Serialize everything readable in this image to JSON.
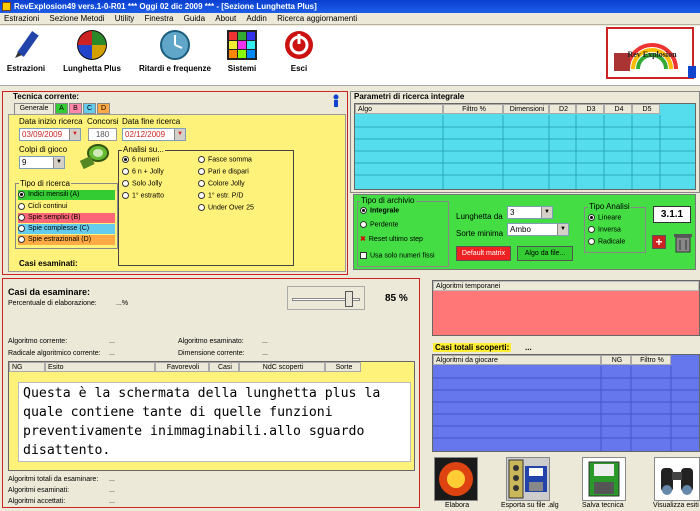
{
  "window": {
    "title": "RevExplosion49 vers.1-0-R01  ***  Oggi 02 dic 2009  ***  - [Sezione Lunghetta Plus]"
  },
  "menu": [
    "Estrazioni",
    "Sezione Metodi",
    "Utility",
    "Finestra",
    "Guida",
    "About",
    "Addin",
    "Ricerca aggiornamenti"
  ],
  "toolbar": {
    "estrazioni": "Estrazioni",
    "lunghetta": "Lunghetta Plus",
    "ritardi": "Ritardi e frequenze",
    "sistemi": "Sistemi",
    "esci": "Esci"
  },
  "logo": {
    "text": "Rev Explosion"
  },
  "tecnica": {
    "title": "Tecnica corrente:",
    "tabs": [
      "Generale",
      "A",
      "B",
      "C",
      "D"
    ],
    "data_inizio_label": "Data inizio ricerca",
    "data_inizio": "03/09/2009",
    "concorsi_label": "Concorsi",
    "concorsi": "180",
    "data_fine_label": "Data fine ricerca",
    "data_fine": "02/12/2009",
    "colpi_label": "Colpi di gioco",
    "colpi": "9",
    "tipo_label": "Tipo di ricerca",
    "tipi": [
      "Indici mensili (A)",
      "Cicli continui",
      "Spie semplici (B)",
      "Spie complesse (C)",
      "Spie estrazionali (D)"
    ],
    "analisi_label": "Analisi su...",
    "analisi_left": [
      "6 numeri",
      "6 n + Jolly",
      "Solo Jolly",
      "1° estratto"
    ],
    "analisi_right": [
      "Fasce somma",
      "Pari e dispari",
      "Colore Jolly",
      "1° estr. P/D",
      "Under Over 25"
    ],
    "casi_label": "Casi esaminati:"
  },
  "parametri": {
    "title": "Parametri di ricerca integrale",
    "cols": [
      "Algo",
      "Filtro %",
      "Dimensioni",
      "D2",
      "D3",
      "D4",
      "D5"
    ]
  },
  "archivio": {
    "tipo_label": "Tipo di archivio",
    "integrale": "Integrale",
    "perdente": "Perdente",
    "reset": "Reset ultimo step",
    "usa_solo": "Usa solo numeri fissi",
    "lunghetta_label": "Lunghetta da",
    "lunghetta": "3",
    "sorte_label": "Sorte minima",
    "sorte": "Ambo",
    "btn_default": "Default matrix",
    "btn_algo": "Algo da file...",
    "analisi_label": "Tipo Analisi",
    "lineare": "Lineare",
    "inversa": "Inversa",
    "radicale": "Radicale",
    "version": "3.1.1"
  },
  "casi": {
    "title": "Casi da esaminare:",
    "percent": "85 %",
    "slider_pct": 0.85,
    "perc_label": "Percentuale di elaborazione:",
    "perc_value": "...%",
    "algo_corr": "Algoritmo corrente:",
    "algo_corr_v": "...",
    "algo_esam": "Algoritmo esaminato:",
    "algo_esam_v": "...",
    "radicale": "Radicale algoritmico corrente:",
    "radicale_v": "...",
    "dimensione": "Dimensione corrente:",
    "dimensione_v": "...",
    "cols": [
      "NG",
      "Esito",
      "Favorevoli",
      "Casi",
      "NdC scoperti",
      "Sorte"
    ],
    "annotation": "Questa è la schermata della lunghetta plus la quale contiene tante di quelle funzioni preventivamente inimmaginabili.allo sguardo disattento.",
    "tot_label": "Algoritmi totali da esaminare:",
    "tot_v": "...",
    "esam_label": "Algoritmi esaminati:",
    "esam_v": "...",
    "acc_label": "Algoritmi accettati:",
    "acc_v": "..."
  },
  "temporanei": {
    "title": "Algoritmi temporanei"
  },
  "scoperti": {
    "title": "Casi totali scoperti:",
    "value": "...",
    "cols": [
      "Algoritmi da giocare",
      "NG",
      "Filtro %"
    ]
  },
  "actions": {
    "elabora": "Elabora",
    "esporta": "Esporta su file .alg",
    "salva": "Salva tecnica",
    "visualizza": "Visualizza esiti"
  }
}
